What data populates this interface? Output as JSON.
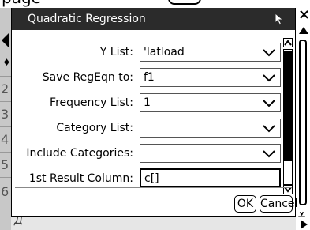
{
  "page_top": {
    "text": "page"
  },
  "sidebar": {
    "row_numbers": [
      "2",
      "3",
      "4",
      "5",
      "6"
    ]
  },
  "dialog": {
    "title": "Quadratic Regression",
    "fields": [
      {
        "label": "Y List:",
        "value": "'latload"
      },
      {
        "label": "Save RegEqn to:",
        "value": "f1"
      },
      {
        "label": "Frequency List:",
        "value": "1"
      },
      {
        "label": "Category List:",
        "value": ""
      },
      {
        "label": "Include Categories:",
        "value": ""
      },
      {
        "label": "1st Result Column:",
        "value": "c[]"
      }
    ],
    "buttons": {
      "ok": "OK",
      "cancel": "Cancel"
    }
  },
  "icons": [
    "cursor-icon",
    "chevron-down-icon",
    "scroll-up-icon",
    "scroll-down-icon",
    "close-icon",
    "left-arrow-icon",
    "play-icon"
  ]
}
